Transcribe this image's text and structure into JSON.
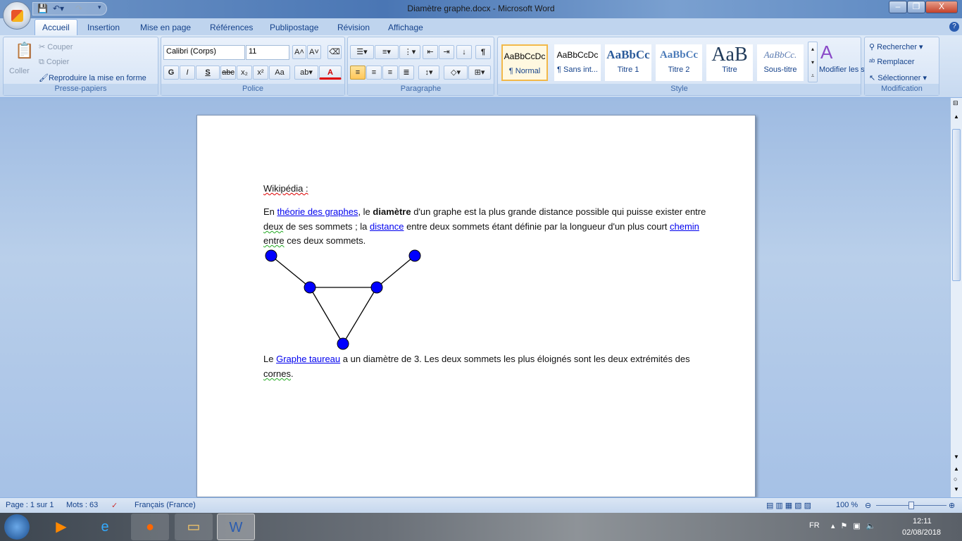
{
  "window": {
    "title": "Diamètre graphe.docx - Microsoft Word",
    "minimize": "–",
    "restore": "❐",
    "close": "X"
  },
  "tabs": [
    {
      "label": "Accueil",
      "active": true
    },
    {
      "label": "Insertion"
    },
    {
      "label": "Mise en page"
    },
    {
      "label": "Références"
    },
    {
      "label": "Publipostage"
    },
    {
      "label": "Révision"
    },
    {
      "label": "Affichage"
    }
  ],
  "ribbon": {
    "clipboard": {
      "paste": "Coller",
      "cut": "Couper",
      "copy": "Copier",
      "format_painter": "Reproduire la mise en forme",
      "label": "Presse-papiers"
    },
    "font": {
      "font_name": "Calibri (Corps)",
      "font_size": "11",
      "bold": "G",
      "italic": "I",
      "underline": "S",
      "strike": "abc",
      "subscript": "x₂",
      "superscript": "x²",
      "case": "Aa",
      "color": "A",
      "label": "Police",
      "font_color_hex": "#e00000"
    },
    "paragraph": {
      "label": "Paragraphe",
      "pilcrow": "¶"
    },
    "styles": {
      "items": [
        {
          "preview": "AaBbCcDc",
          "name": "¶ Normal",
          "active": true
        },
        {
          "preview": "AaBbCcDc",
          "name": "¶ Sans int..."
        },
        {
          "preview": "AaBbCc",
          "name": "Titre 1"
        },
        {
          "preview": "AaBbCc",
          "name": "Titre 2"
        },
        {
          "preview": "AaB",
          "name": "Titre"
        },
        {
          "preview": "AaBbCc.",
          "name": "Sous-titre"
        }
      ],
      "change_styles": "Modifier les styles",
      "label": "Style"
    },
    "editing": {
      "find": "Rechercher",
      "replace": "Remplacer",
      "select": "Sélectionner",
      "label": "Modification"
    }
  },
  "document": {
    "heading": "Wikipédia :",
    "p1": {
      "t1": "En ",
      "link1": "théorie des graphes",
      "t2": ", le ",
      "bold": "diamètre",
      "t3": " d'un graphe est la plus grande distance possible qui puisse exister entre",
      "t4": "deux",
      "t5": " de ses sommets ; la ",
      "link2": "distance",
      "t6": " entre deux sommets étant définie par la longueur d'un plus court ",
      "link3": "chemin",
      "t7": "entre",
      "t8": " ces deux sommets."
    },
    "graph": {
      "node_color": "#0000ff",
      "nodes": [
        {
          "id": "a"
        },
        {
          "id": "b"
        },
        {
          "id": "c"
        },
        {
          "id": "d"
        },
        {
          "id": "e"
        }
      ],
      "edges": [
        [
          "a",
          "c"
        ],
        [
          "c",
          "d"
        ],
        [
          "d",
          "b"
        ],
        [
          "c",
          "e"
        ],
        [
          "d",
          "e"
        ]
      ]
    },
    "p2": {
      "t1": "Le ",
      "link": "Graphe taureau",
      "t2": " a un diamètre de 3. Les deux sommets les plus éloignés sont les deux extrémités des",
      "t3": "cornes",
      "t4": "."
    }
  },
  "status": {
    "page": "Page : 1 sur 1",
    "words": "Mots : 63",
    "language": "Français (France)",
    "zoom": "100 %",
    "zoom_level": 100
  },
  "taskbar": {
    "lang": "FR",
    "time": "12:11",
    "date": "02/08/2018"
  }
}
